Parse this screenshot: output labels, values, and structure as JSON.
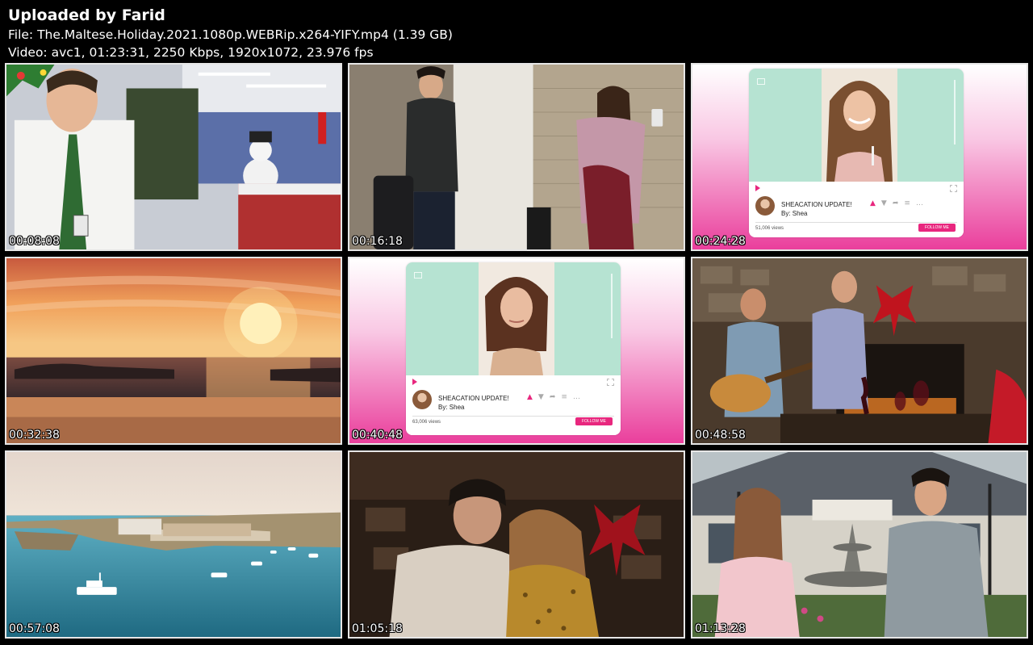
{
  "header": {
    "title": "Uploaded by Farid",
    "file_line": "File: The.Maltese.Holiday.2021.1080p.WEBRip.x264-YIFY.mp4 (1.39 GB)",
    "video_line": "Video: avc1, 01:23:31, 2250 Kbps, 1920x1072, 23.976 fps"
  },
  "thumbnails": [
    {
      "timestamp": "00:08:08",
      "scene": "office-reception"
    },
    {
      "timestamp": "00:16:18",
      "scene": "airport-hallway"
    },
    {
      "timestamp": "00:24:28",
      "scene": "vlog-card"
    },
    {
      "timestamp": "00:32:38",
      "scene": "sunset-sea"
    },
    {
      "timestamp": "00:40:48",
      "scene": "vlog-card"
    },
    {
      "timestamp": "00:48:58",
      "scene": "fireplace-guitar"
    },
    {
      "timestamp": "00:57:08",
      "scene": "coast-aerial"
    },
    {
      "timestamp": "01:05:18",
      "scene": "embrace-fireplace"
    },
    {
      "timestamp": "01:13:28",
      "scene": "mansion-fountain"
    }
  ],
  "vlog_card_1": {
    "title": "SHEACATION UPDATE!",
    "byline": "By: Shea",
    "views": "51,006 views",
    "follow": "FOLLOW ME"
  },
  "vlog_card_2": {
    "title": "SHEACATION UPDATE!",
    "byline": "By: Shea",
    "views": "63,006 views",
    "follow": "FOLLOW ME"
  },
  "colors": {
    "background": "#000000",
    "thumb_border": "#e6e6e6",
    "vlog_pink": "#e8277e",
    "vlog_mint": "#b6e3d2"
  }
}
